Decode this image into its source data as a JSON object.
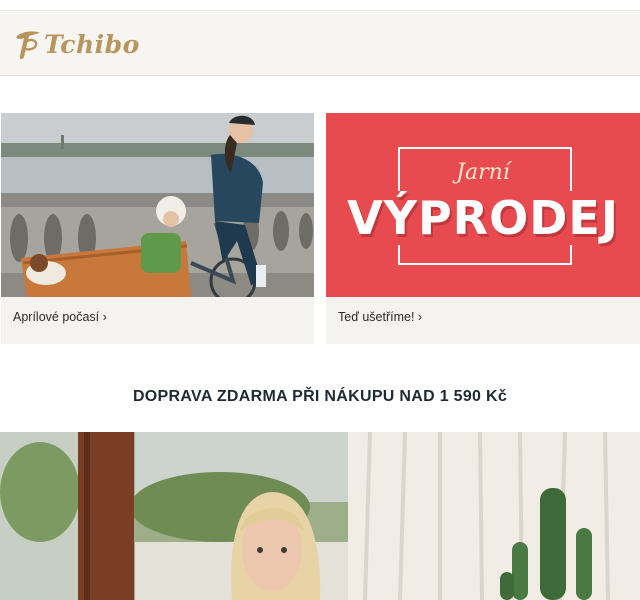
{
  "header": {
    "logo_text": "Tchibo",
    "brand_color": "#b8955c",
    "background": "#f7f5f1"
  },
  "teasers": [
    {
      "link_label": "Aprílové počasí ›",
      "image": "family-cycling-photo"
    },
    {
      "link_label": "Teď ušetříme! ›",
      "image": "spring-sale-banner",
      "banner_script": "Jarní",
      "banner_title": "VÝPRODEJ",
      "banner_color": "#e84b4f"
    }
  ],
  "promo": {
    "text": "DOPRAVA ZDARMA PŘI NÁKUPU NAD 1 590 Kč"
  },
  "hero": {
    "image": "woman-by-window-photo"
  }
}
